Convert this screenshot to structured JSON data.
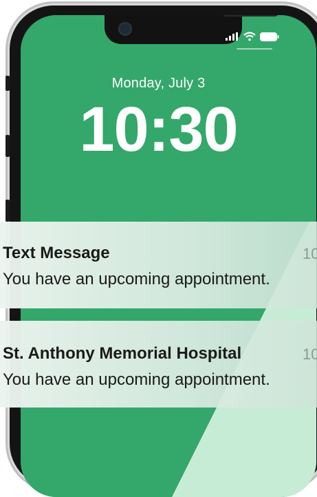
{
  "colors": {
    "wallpaper": "#34a76b",
    "wallpaper_light": "#c7ecd6",
    "frame": "#141414"
  },
  "status_bar": {
    "icons": [
      "cellular-signal-icon",
      "wifi-icon",
      "battery-icon"
    ]
  },
  "lockscreen": {
    "date": "Monday, July 3",
    "time": "10:30"
  },
  "notifications": [
    {
      "title": "Text Message",
      "time": "10",
      "body": "You have an upcoming appointment."
    },
    {
      "title": "St. Anthony Memorial Hospital",
      "time": "10",
      "body": "You have an upcoming appointment."
    }
  ]
}
